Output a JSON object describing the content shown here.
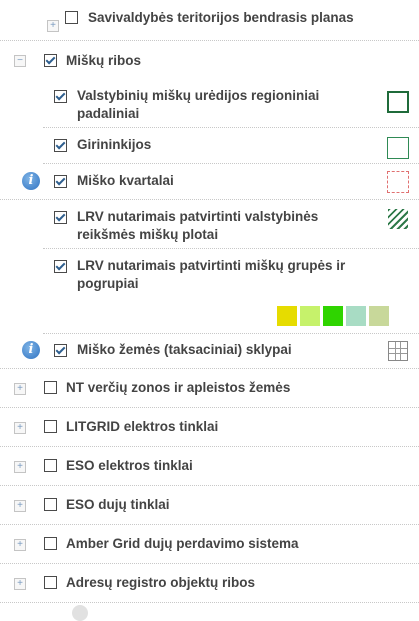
{
  "layers": {
    "savivaldybes": "Savivaldybės teritorijos bendrasis planas",
    "misku_ribos": "Miškų ribos",
    "valstybiniu": "Valstybinių miškų urėdijos regioniniai padaliniai",
    "girininkijos": "Girininkijos",
    "kvartalai": "Miško kvartalai",
    "lrv_plotai": "LRV nutarimais patvirtinti valstybinės reikšmės miškų plotai",
    "lrv_grupes": "LRV nutarimais patvirtinti miškų grupės ir pogrupiai",
    "zemes": "Miško žemės (taksaciniai) sklypai",
    "nt": "NT verčių zonos ir apleistos žemės",
    "litgrid": "LITGRID elektros tinklai",
    "eso_el": "ESO elektros tinklai",
    "eso_duj": "ESO dujų tinklai",
    "amber": "Amber Grid dujų perdavimo sistema",
    "adresu": "Adresų registro objektų ribos"
  },
  "toggles": {
    "expand": "+",
    "collapse": "−"
  },
  "info_glyph": "i",
  "icons": {
    "regions": "square-outline-dark-green-icon",
    "girininkijos": "square-outline-green-icon",
    "kvartalai": "dashed-square-red-icon",
    "plotai": "hatch-pattern-icon",
    "sklypai": "grid-square-icon"
  },
  "swatch_colors": [
    "#e6dc00",
    "#c6f26b",
    "#2fd400",
    "#a8dcc4",
    "#c8d89a"
  ]
}
